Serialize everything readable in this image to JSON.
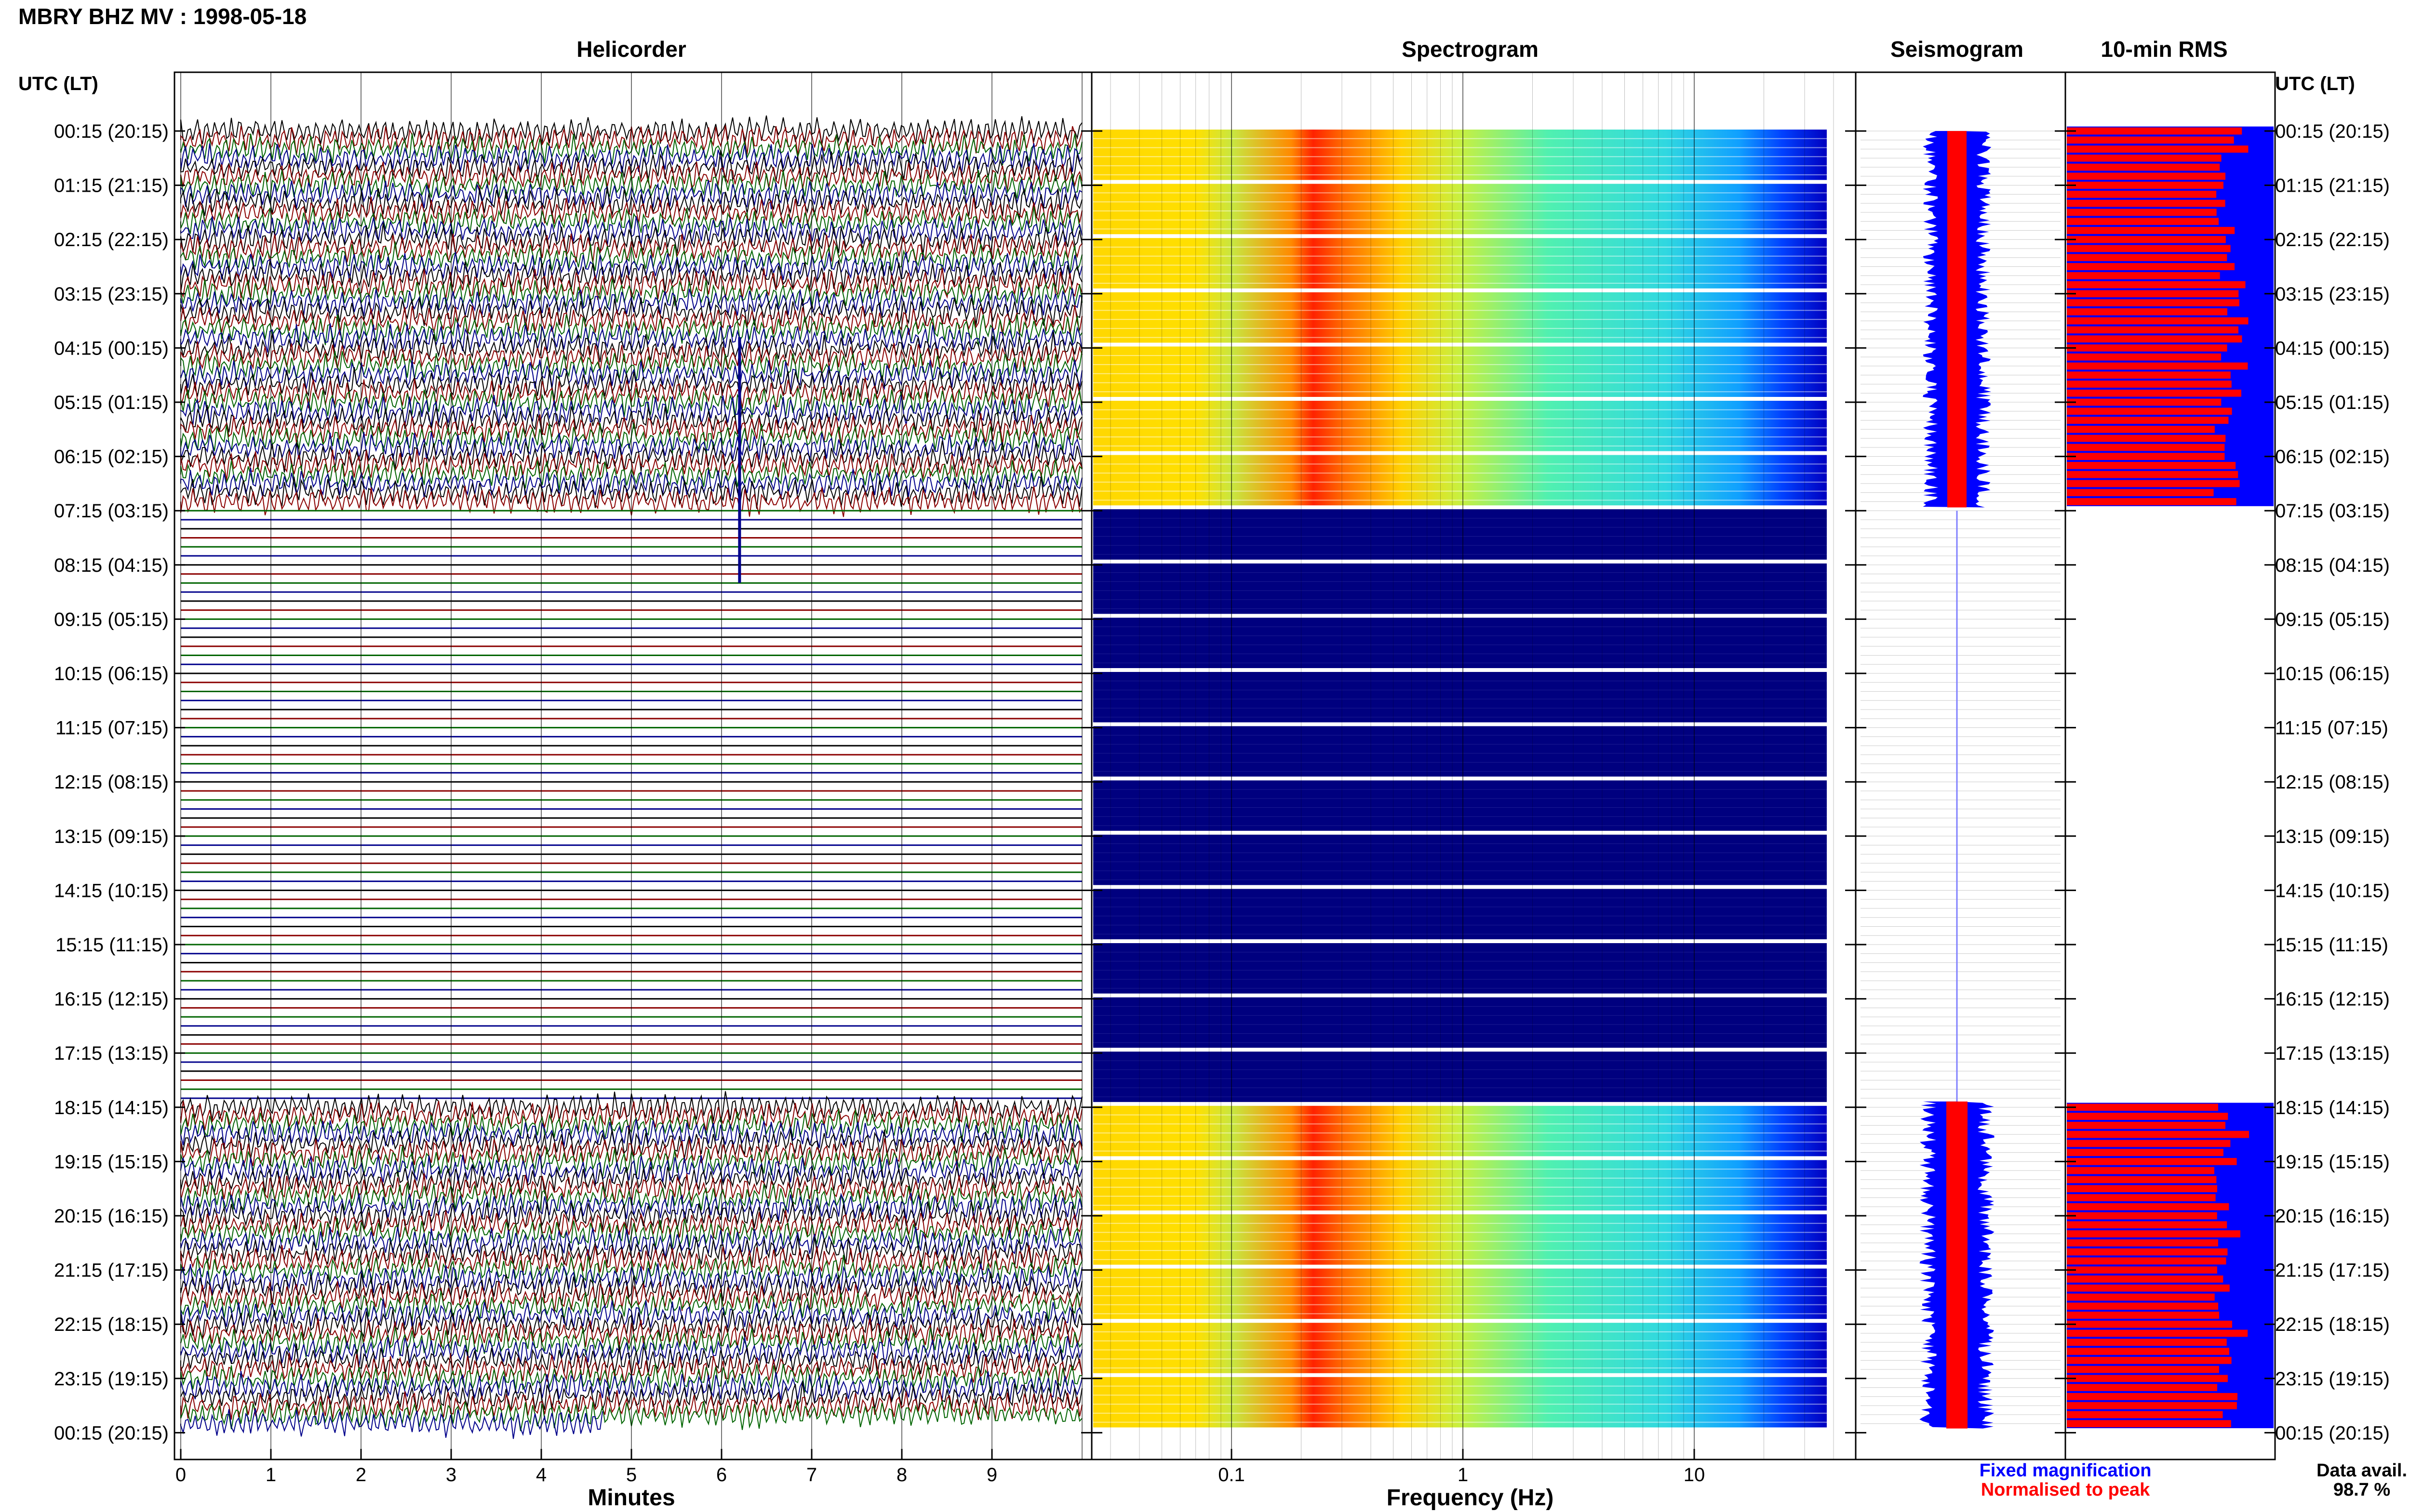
{
  "title": "MBRY BHZ MV : 1998-05-18",
  "panels": {
    "helicorder": "Helicorder",
    "spectrogram": "Spectrogram",
    "seismogram": "Seismogram",
    "rms": "10-min RMS"
  },
  "axis_header_left": "UTC (LT)",
  "axis_header_right": "UTC (LT)",
  "time_labels": [
    "00:15 (20:15)",
    "01:15 (21:15)",
    "02:15 (22:15)",
    "03:15 (23:15)",
    "04:15 (00:15)",
    "05:15 (01:15)",
    "06:15 (02:15)",
    "07:15 (03:15)",
    "08:15 (04:15)",
    "09:15 (05:15)",
    "10:15 (06:15)",
    "11:15 (07:15)",
    "12:15 (08:15)",
    "13:15 (09:15)",
    "14:15 (10:15)",
    "15:15 (11:15)",
    "16:15 (12:15)",
    "17:15 (13:15)",
    "18:15 (14:15)",
    "19:15 (15:15)",
    "20:15 (16:15)",
    "21:15 (17:15)",
    "22:15 (18:15)",
    "23:15 (19:15)",
    "00:15 (20:15)"
  ],
  "helicorder_xaxis": {
    "label": "Minutes",
    "ticks": [
      "0",
      "1",
      "2",
      "3",
      "4",
      "5",
      "6",
      "7",
      "8",
      "9"
    ]
  },
  "spectrogram_xaxis": {
    "label": "Frequency (Hz)",
    "ticks": [
      "0.1",
      "1",
      "10"
    ],
    "scale": "log"
  },
  "legend": {
    "fixed": "Fixed magnification",
    "normalised": "Normalised to peak",
    "fixed_color": "#0000ff",
    "normalised_color": "#ff0000"
  },
  "data_avail_label": "Data avail.",
  "data_avail_value": "98.7 %",
  "colors": {
    "trace_cycle": [
      "#000000",
      "#8b0000",
      "#006400",
      "#00008b"
    ],
    "no_data": "#00007f",
    "rms_fixed": "#0000ff",
    "rms_normalised": "#ff0000"
  },
  "data_gap": {
    "start": "07:15 (03:15)",
    "end": "18:15 (14:15)"
  }
}
